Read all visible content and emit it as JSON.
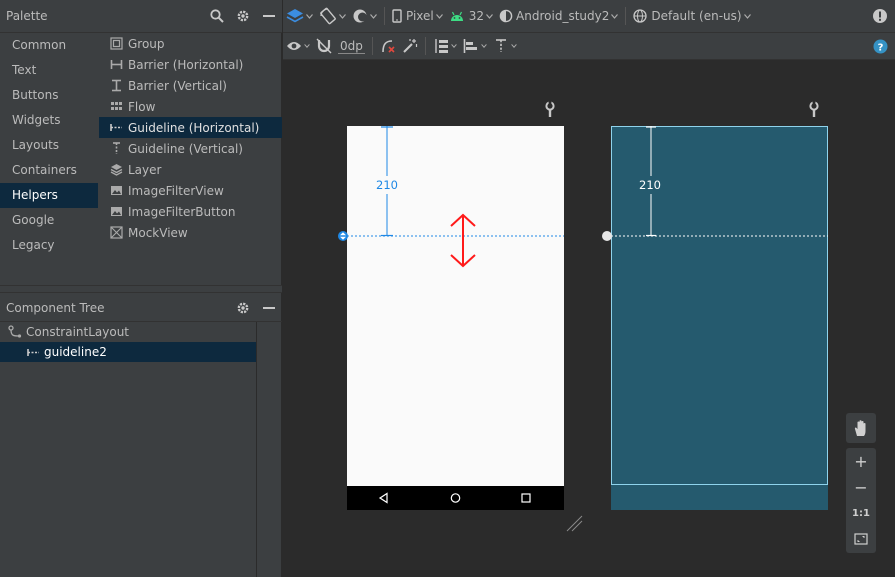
{
  "palette": {
    "title": "Palette",
    "categories": [
      "Common",
      "Text",
      "Buttons",
      "Widgets",
      "Layouts",
      "Containers",
      "Helpers",
      "Google",
      "Legacy"
    ],
    "selected_category": "Helpers",
    "items": [
      {
        "label": "Group",
        "icon": "group-icon"
      },
      {
        "label": "Barrier (Horizontal)",
        "icon": "barrier-horizontal-icon"
      },
      {
        "label": "Barrier (Vertical)",
        "icon": "barrier-vertical-icon"
      },
      {
        "label": "Flow",
        "icon": "flow-icon"
      },
      {
        "label": "Guideline (Horizontal)",
        "icon": "guideline-horizontal-icon"
      },
      {
        "label": "Guideline (Vertical)",
        "icon": "guideline-vertical-icon"
      },
      {
        "label": "Layer",
        "icon": "layer-icon"
      },
      {
        "label": "ImageFilterView",
        "icon": "image-icon"
      },
      {
        "label": "ImageFilterButton",
        "icon": "image-icon"
      },
      {
        "label": "MockView",
        "icon": "mockview-icon"
      }
    ],
    "selected_item": "Guideline (Horizontal)"
  },
  "component_tree": {
    "title": "Component Tree",
    "nodes": [
      {
        "label": "ConstraintLayout",
        "depth": 0
      },
      {
        "label": "guideline2",
        "depth": 1
      }
    ],
    "selected_node": "guideline2"
  },
  "toolbar": {
    "device": "Pixel",
    "api_level": "32",
    "theme": "Android_study2",
    "locale": "Default (en-us)",
    "default_margin": "0dp"
  },
  "design": {
    "guideline_offset_label": "210",
    "blueprint_offset_label": "210"
  },
  "zoom": {
    "zoom_in": "+",
    "zoom_out": "−",
    "actual_size": "1:1"
  },
  "colors": {
    "selection_bg": "#0d293e",
    "panel_bg": "#3c3f41",
    "canvas_bg": "#2b2b2b",
    "blueprint_bg": "#255a6e",
    "guideline": "#1e88e5",
    "arrow_annotation": "#ff1a1a"
  }
}
